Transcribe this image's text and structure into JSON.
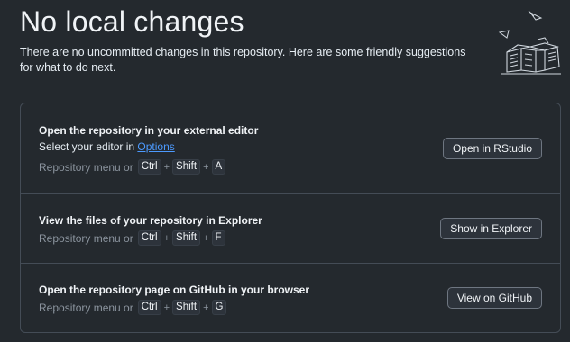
{
  "header": {
    "title": "No local changes",
    "subtitle": "There are no uncommitted changes in this repository. Here are some friendly suggestions for what to do next."
  },
  "actions": [
    {
      "title": "Open the repository in your external editor",
      "description_prefix": "Select your editor in ",
      "description_link": "Options",
      "shortcut_prefix": "Repository menu or",
      "keys": [
        "Ctrl",
        "Shift",
        "A"
      ],
      "button_label": "Open in RStudio"
    },
    {
      "title": "View the files of your repository in Explorer",
      "shortcut_prefix": "Repository menu or",
      "keys": [
        "Ctrl",
        "Shift",
        "F"
      ],
      "button_label": "Show in Explorer"
    },
    {
      "title": "Open the repository page on GitHub in your browser",
      "shortcut_prefix": "Repository menu or",
      "keys": [
        "Ctrl",
        "Shift",
        "G"
      ],
      "button_label": "View on GitHub"
    }
  ],
  "colors": {
    "background": "#24292e",
    "border": "#444c56",
    "link": "#4c9aff",
    "muted_text": "#8b949e"
  },
  "icons": {
    "illustration": "empty-boxes-illustration-icon"
  }
}
